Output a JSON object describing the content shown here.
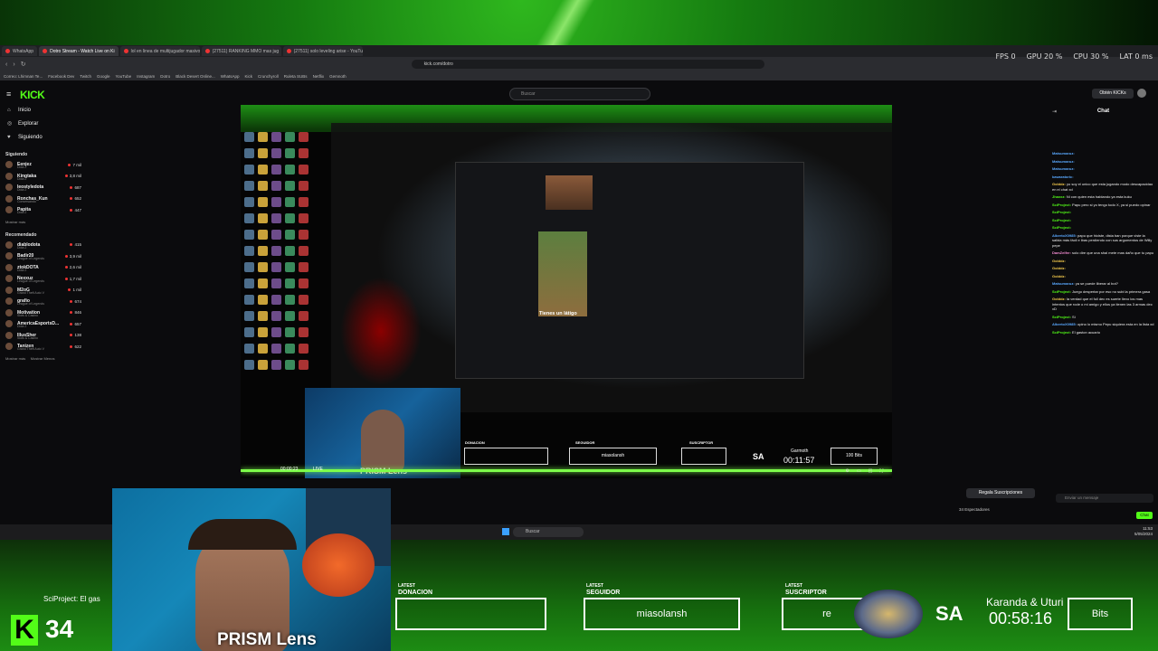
{
  "overlay": {
    "stats": {
      "fps": "FPS  0",
      "gpu": "GPU 20 %",
      "cpu": "CPU 30 %",
      "lat": "LAT 0 ms"
    },
    "kick_count": "34",
    "chat_ticker": "SciProject: El gas",
    "webcam_label": "PRISM Lens",
    "donation_label": "DONACION",
    "donation_value": "",
    "follower_label": "SEGUIDOR",
    "follower_value": "miasolansh",
    "subscriber_label": "SUSCRIPTOR",
    "subscriber_value": "re",
    "latest_prefix": "LATEST",
    "bits_value": "Bits",
    "sa": "SA",
    "karanda": "Karanda & Uturi",
    "timer": "00:58:16",
    "accent": "#53fc18"
  },
  "browser": {
    "tabs": [
      {
        "label": "WhatsApp",
        "active": false
      },
      {
        "label": "Dotro Stream - Watch Live on Ki",
        "active": true
      },
      {
        "label": "lol en linea de multijugador masivo",
        "active": false
      },
      {
        "label": "(27511) RANKING MMO mas jug",
        "active": false
      },
      {
        "label": "(27511) solo leveling arise - YouTube",
        "active": false
      }
    ],
    "url": "kick.com/dotro",
    "bookmarks": [
      "Correo: Lhimnan Te...",
      "Facebook Dev",
      "Twitch",
      "Google",
      "YouTube",
      "Instagram",
      "Dotro",
      "Black Desert Online...",
      "WhatsApp",
      "Kick",
      "Crunchyroll",
      "Ruleta SUBs",
      "Netflix",
      "Gemnoth"
    ]
  },
  "kick": {
    "logo": "KICK",
    "search_placeholder": "Buscar",
    "get_kicks": "Obtén KICKs",
    "nav": [
      {
        "icon": "home-icon",
        "label": "Inicio"
      },
      {
        "icon": "compass-icon",
        "label": "Explorar"
      },
      {
        "icon": "heart-icon",
        "label": "Siguiendo"
      }
    ],
    "following_title": "Siguiendo",
    "following": [
      {
        "name": "Eenjez",
        "game": "Dota 2",
        "viewers": "7 mil"
      },
      {
        "name": "Kingtaka",
        "game": "Dota 2",
        "viewers": "3,8 mil"
      },
      {
        "name": "leostyledota",
        "game": "Dota 2",
        "viewers": "687"
      },
      {
        "name": "Ronchas_Kun",
        "game": "Conversando",
        "viewers": "652"
      },
      {
        "name": "Papita",
        "game": "Dota 2",
        "viewers": "447"
      }
    ],
    "show_all": "Mostrar más",
    "recommended_title": "Recomendado",
    "recommended": [
      {
        "name": "diablodota",
        "game": "Dota 2",
        "viewers": "415"
      },
      {
        "name": "Badir20",
        "game": "League of Legends",
        "viewers": "3,9 mil"
      },
      {
        "name": "ztokDOTA",
        "game": "Dota 2",
        "viewers": "2,6 mil"
      },
      {
        "name": "Nexxuz",
        "game": "League of Legends",
        "viewers": "1,7 mil"
      },
      {
        "name": "M2oG",
        "game": "Grand Theft Auto V",
        "viewers": "1 mil"
      },
      {
        "name": "grafio",
        "game": "League of Legends",
        "viewers": "674"
      },
      {
        "name": "Motivation",
        "game": "Slots & Casino",
        "viewers": "846"
      },
      {
        "name": "AmericaEsportsD...",
        "game": "Dota 2",
        "viewers": "657"
      },
      {
        "name": "IllusSher",
        "game": "Slots & Casino",
        "viewers": "138"
      },
      {
        "name": "Tanizen",
        "game": "Grand Theft Auto V",
        "viewers": "622"
      }
    ],
    "show_more": "Mostrar más",
    "show_less": "Mostrar Menos",
    "gift_subs": "Regala Suscripciones",
    "viewers": "34 Espectadores",
    "chat_title": "Chat",
    "chat_placeholder": "Enviar un mensaje",
    "chat_send": "Chat",
    "chat_messages": [
      {
        "user": "Matsumaruz:",
        "text": "",
        "color": "#5aa9ff"
      },
      {
        "user": "Matsumaruz:",
        "text": "",
        "color": "#5aa9ff"
      },
      {
        "user": "Matsumaruz:",
        "text": "",
        "color": "#5aa9ff"
      },
      {
        "user": "kawaratoric:",
        "text": "",
        "color": "#5aa9ff"
      },
      {
        "user": "Golddz:",
        "text": "yo soy el unico que esta jugando modo descapacidao en el chat xd",
        "color": "#f2c94c"
      },
      {
        "user": "Jhaxxz:",
        "text": "Ni con quien esta hablando ya esta kuku",
        "color": "#53fc18"
      },
      {
        "user": "SciProject:",
        "text": "Papu pero si yo tengo todo X, ya si puedo opinar",
        "color": "#53fc18"
      },
      {
        "user": "SciProject:",
        "text": "",
        "color": "#53fc18"
      },
      {
        "user": "SciProject:",
        "text": "",
        "color": "#53fc18"
      },
      {
        "user": "SciProject:",
        "text": "",
        "color": "#53fc18"
      },
      {
        "user": "AlbertoX0985:",
        "text": "papu que hiciste, dista ban porque viste la salida más fácil e ibas perdiendo con sus argumentos de Willy pepe",
        "color": "#5aa9ff"
      },
      {
        "user": "DamZelfer:",
        "text": "solo dire que una shal mete mas daño que tu papu",
        "color": "#f28bd1"
      },
      {
        "user": "Golddz:",
        "text": "",
        "color": "#f2c94c"
      },
      {
        "user": "Golddz:",
        "text": "",
        "color": "#f2c94c"
      },
      {
        "user": "Golddz:",
        "text": "",
        "color": "#f2c94c"
      },
      {
        "user": "Matsumaruz:",
        "text": "ya se puede liberar al bot?",
        "color": "#5aa9ff"
      },
      {
        "user": "SciProject:",
        "text": "Juego despertar por eso no subi la primera gasa",
        "color": "#53fc18"
      },
      {
        "user": "Golddz:",
        "text": "la verdad que el full dec es suerte llevo los mas intentos que rode o mi amigo y ellos ya tienen las 3 armas dec xD",
        "color": "#f2c94c"
      },
      {
        "user": "SciProject:",
        "text": "Si",
        "color": "#53fc18"
      },
      {
        "user": "AlbertoX0985:",
        "text": "opino lo mismo Pepu siquiera esta en la lista xd",
        "color": "#5aa9ff"
      },
      {
        "user": "SciProject:",
        "text": "El gaston acuario",
        "color": "#53fc18"
      }
    ]
  },
  "stream_video": {
    "inner_caption": "Tienes un látigo",
    "time": "00:00:23",
    "live": "LIVE",
    "cam_label": "PRISM Lens",
    "donation_label": "DONACION",
    "follower_label": "SEGUIDOR",
    "follower_value": "miasolansh",
    "subscriber_label": "SUSCRIPTOR",
    "sa": "SA",
    "karanda": "Garmoth",
    "timer": "00:11:57",
    "bits": "100 Bits"
  },
  "taskbar": {
    "search": "Buscar",
    "time": "11:53",
    "date": "5/05/2024"
  }
}
